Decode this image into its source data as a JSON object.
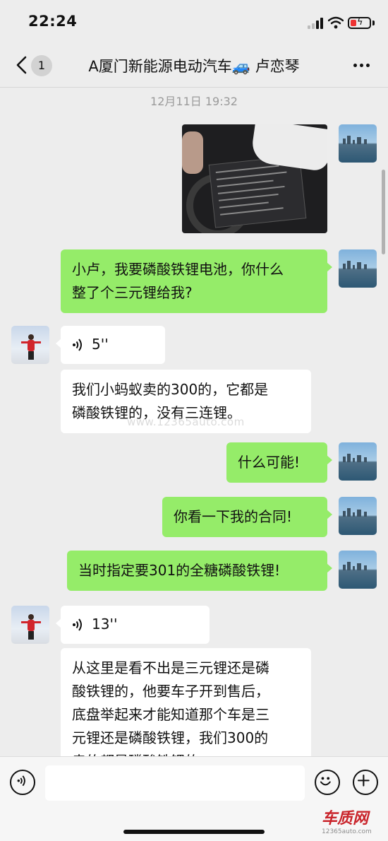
{
  "status_bar": {
    "time": "22:24"
  },
  "nav": {
    "unread_count": "1",
    "title": "A厦门新能源电动汽车🚙 卢恋琴"
  },
  "chat": {
    "timestamp": "12月11日 19:32",
    "messages": [
      {
        "sender": "me",
        "type": "image"
      },
      {
        "sender": "me",
        "type": "text",
        "lines": [
          "小卢，我要磷酸铁锂电池，你什么",
          "整了个三元锂给我?"
        ]
      },
      {
        "sender": "them",
        "type": "voice",
        "duration": "5''"
      },
      {
        "sender": "them",
        "type": "text",
        "lines": [
          "我们小蚂蚁卖的300的，它都是",
          "磷酸铁锂的，没有三连锂。"
        ]
      },
      {
        "sender": "me",
        "type": "text",
        "lines": [
          "什么可能!"
        ]
      },
      {
        "sender": "me",
        "type": "text",
        "lines": [
          "你看一下我的合同!"
        ]
      },
      {
        "sender": "me",
        "type": "text",
        "lines": [
          "当时指定要301的全糖磷酸铁锂!"
        ]
      },
      {
        "sender": "them",
        "type": "voice",
        "duration": "13''"
      },
      {
        "sender": "them",
        "type": "text",
        "lines": [
          "从这里是看不出是三元锂还是磷",
          "酸铁锂的，他要车子开到售后，",
          "底盘举起来才能知道那个车是三",
          "元锂还是磷酸铁锂，我们300的",
          "卖的都是磷酸铁锂的。"
        ]
      }
    ]
  },
  "watermark": "www.12365auto.com",
  "logo": {
    "name": "车质网",
    "url": "12365auto.com"
  },
  "colors": {
    "my_bubble": "#95ec69",
    "their_bubble": "#ffffff",
    "background": "#ededed"
  },
  "icons": [
    "back-arrow-icon",
    "more-icon",
    "voice-wave-icon",
    "voice-input-icon",
    "emoji-icon",
    "plus-icon"
  ]
}
